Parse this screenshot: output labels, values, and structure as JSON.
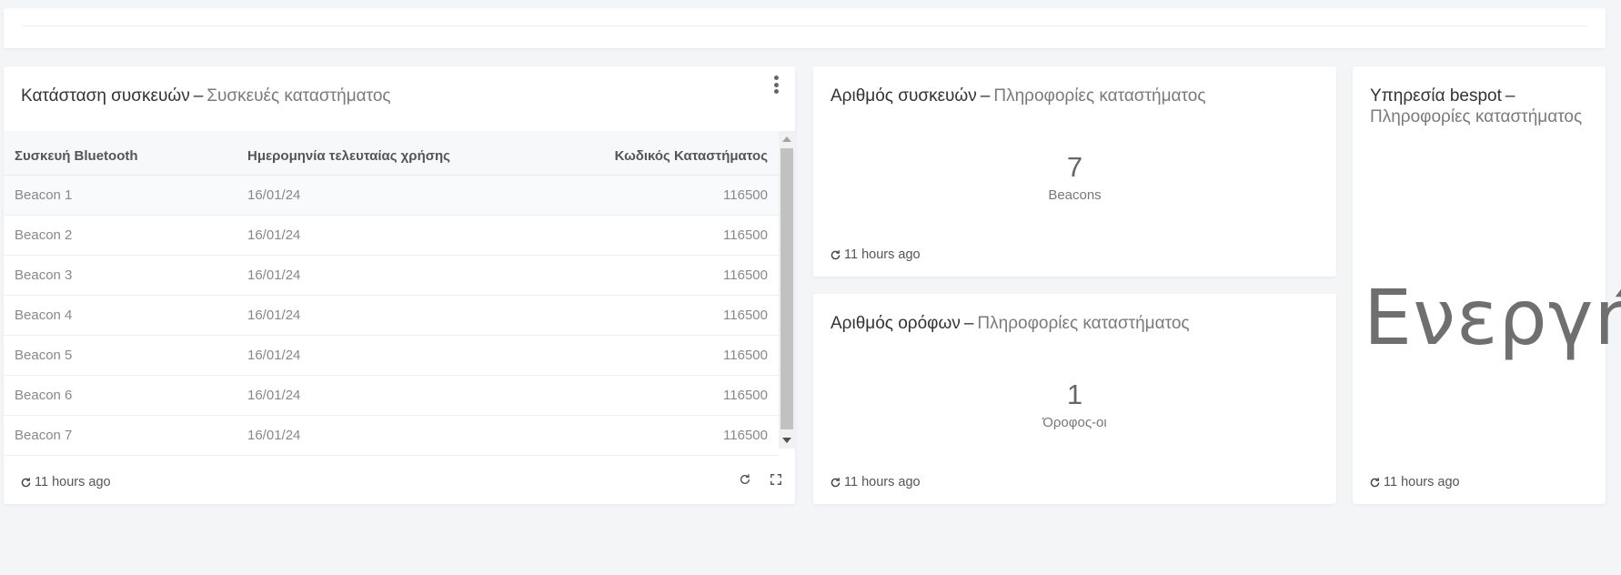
{
  "devices_card": {
    "title": "Κατάσταση συσκευών",
    "separator": "–",
    "subtitle": "Συσκευές καταστήματος",
    "columns": [
      "Συσκευή Bluetooth",
      "Ημερομηνία τελευταίας χρήσης",
      "Κωδικός Καταστήματος"
    ],
    "rows": [
      [
        "Beacon 1",
        "16/01/24",
        "116500"
      ],
      [
        "Beacon 2",
        "16/01/24",
        "116500"
      ],
      [
        "Beacon 3",
        "16/01/24",
        "116500"
      ],
      [
        "Beacon 4",
        "16/01/24",
        "116500"
      ],
      [
        "Beacon 5",
        "16/01/24",
        "116500"
      ],
      [
        "Beacon 6",
        "16/01/24",
        "116500"
      ],
      [
        "Beacon 7",
        "16/01/24",
        "116500"
      ]
    ],
    "refresh_text": "11 hours ago"
  },
  "kpi_devices": {
    "title": "Αριθμός συσκευών",
    "separator": "–",
    "subtitle": "Πληροφορίες καταστήματος",
    "value": "7",
    "unit": "Beacons",
    "refresh_text": "11 hours ago"
  },
  "kpi_floors": {
    "title": "Αριθμός ορόφων",
    "separator": "–",
    "subtitle": "Πληροφορίες καταστήματος",
    "value": "1",
    "unit": "Όροφος-οι",
    "refresh_text": "11 hours ago"
  },
  "service_card": {
    "title": "Υπηρεσία bespot",
    "separator": "–",
    "subtitle": "Πληροφορίες καταστήματος",
    "status": "Ενεργή",
    "refresh_text": "11 hours ago"
  },
  "icons": {
    "refresh": "refresh-icon",
    "menu": "kebab-menu-icon",
    "fullscreen": "fullscreen-icon"
  }
}
